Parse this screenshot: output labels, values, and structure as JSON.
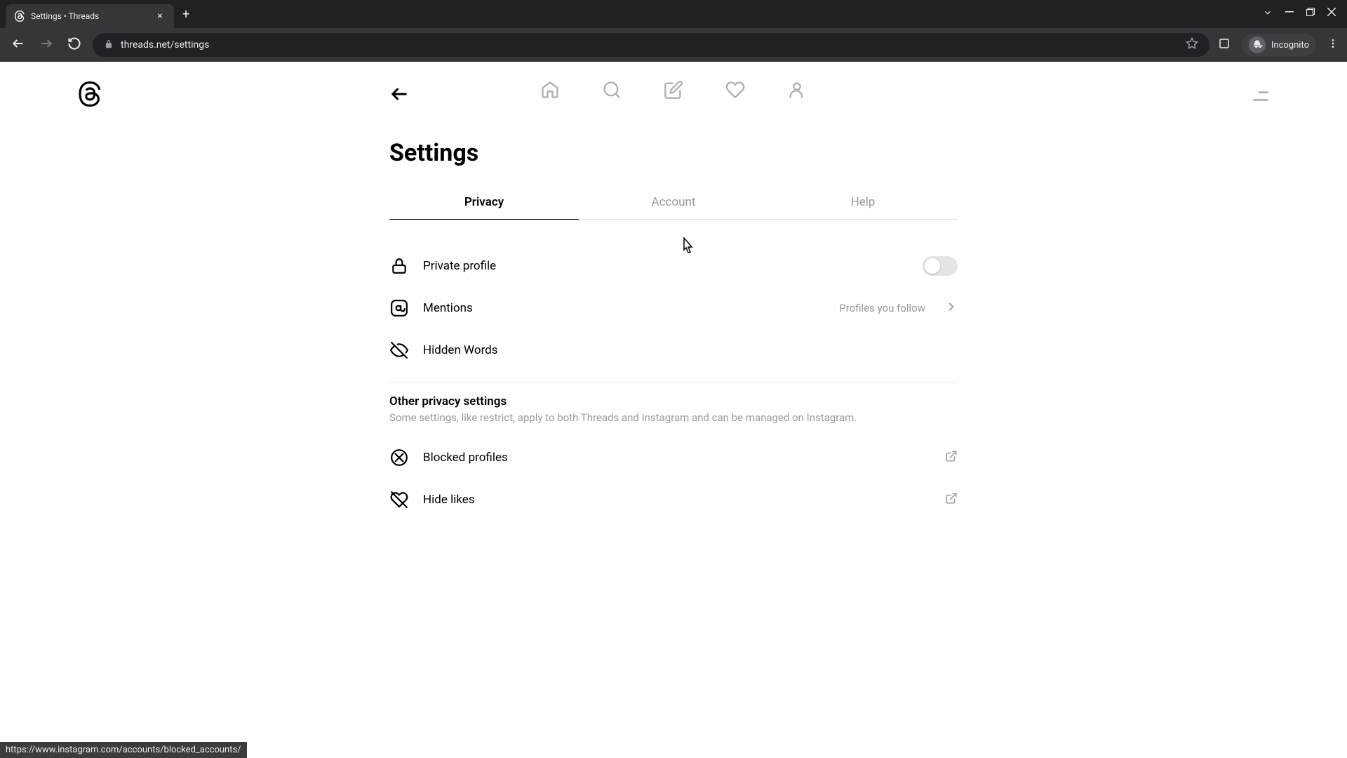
{
  "browser": {
    "tab_title": "Settings • Threads",
    "url": "threads.net/settings",
    "incognito_label": "Incognito"
  },
  "page": {
    "title": "Settings",
    "tabs": {
      "privacy": "Privacy",
      "account": "Account",
      "help": "Help"
    },
    "settings": {
      "private_profile": "Private profile",
      "mentions": "Mentions",
      "mentions_value": "Profiles you follow",
      "hidden_words": "Hidden Words"
    },
    "other_section": {
      "title": "Other privacy settings",
      "description": "Some settings, like restrict, apply to both Threads and Instagram and can be managed on Instagram.",
      "blocked_profiles": "Blocked profiles",
      "hide_likes": "Hide likes"
    }
  },
  "status_bar": "https://www.instagram.com/accounts/blocked_accounts/"
}
